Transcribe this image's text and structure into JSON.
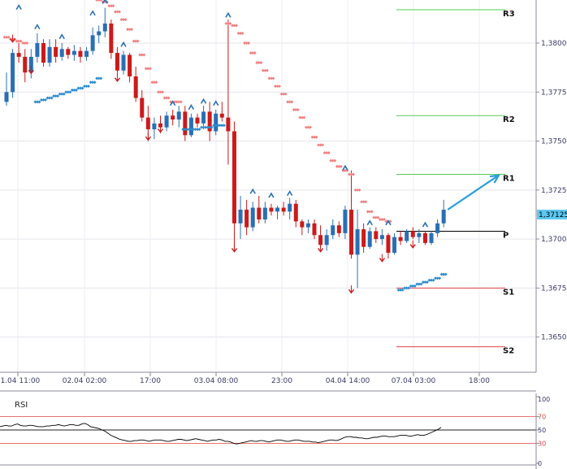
{
  "colors": {
    "bull": "#2a6fb5",
    "bear": "#cc1a1a",
    "sar_high": "#f08080",
    "sar_low": "#2a8ccf",
    "resistance": "#55cc55",
    "support": "#dd4444",
    "pivot": "#000000",
    "arrow": "#2aa0d8",
    "price_tag_bg": "#5bc8f0",
    "rsi_line": "#000000"
  },
  "chart_data": [
    {
      "type": "candlestick",
      "x_labels": [
        "01.04 11:00",
        "02.04 02:00",
        "17:00",
        "03.04 08:00",
        "23:00",
        "04.04 14:00",
        "07.04 03:00",
        "18:00"
      ],
      "y_ticks": [
        "1,3800",
        "1,3775",
        "1,3750",
        "1,3725",
        "1,3700",
        "1,3675",
        "1,3650"
      ],
      "ylim": [
        1.3632,
        1.3822
      ],
      "current_price_label": "1,37125",
      "current_price": 1.37125,
      "pivot_levels": [
        {
          "name": "R3",
          "value": 1.3817
        },
        {
          "name": "R2",
          "value": 1.3763
        },
        {
          "name": "R1",
          "value": 1.3733
        },
        {
          "name": "P",
          "value": 1.3704
        },
        {
          "name": "S1",
          "value": 1.3675
        },
        {
          "name": "S2",
          "value": 1.3645
        }
      ],
      "candles": [
        [
          1.377,
          1.3785,
          1.3768,
          1.3775
        ],
        [
          1.3775,
          1.3797,
          1.3772,
          1.3795
        ],
        [
          1.3795,
          1.38,
          1.379,
          1.3793
        ],
        [
          1.3793,
          1.3797,
          1.378,
          1.3785
        ],
        [
          1.3785,
          1.3797,
          1.3782,
          1.3793
        ],
        [
          1.3793,
          1.3805,
          1.379,
          1.38
        ],
        [
          1.38,
          1.3802,
          1.3788,
          1.379
        ],
        [
          1.379,
          1.3802,
          1.3788,
          1.3798
        ],
        [
          1.3798,
          1.3802,
          1.379,
          1.3793
        ],
        [
          1.3793,
          1.38,
          1.3791,
          1.3797
        ],
        [
          1.3797,
          1.3798,
          1.3792,
          1.3794
        ],
        [
          1.3794,
          1.3799,
          1.3791,
          1.3796
        ],
        [
          1.3796,
          1.3798,
          1.379,
          1.3793
        ],
        [
          1.3793,
          1.3798,
          1.3791,
          1.3796
        ],
        [
          1.3796,
          1.3808,
          1.3794,
          1.3804
        ],
        [
          1.3804,
          1.3809,
          1.38,
          1.3806
        ],
        [
          1.3806,
          1.3818,
          1.3803,
          1.381
        ],
        [
          1.381,
          1.3812,
          1.3792,
          1.3795
        ],
        [
          1.3795,
          1.3798,
          1.3784,
          1.3786
        ],
        [
          1.3786,
          1.3796,
          1.3784,
          1.3794
        ],
        [
          1.3794,
          1.3795,
          1.378,
          1.3783
        ],
        [
          1.3783,
          1.3788,
          1.377,
          1.3772
        ],
        [
          1.3772,
          1.3776,
          1.376,
          1.3762
        ],
        [
          1.3762,
          1.3768,
          1.375,
          1.3756
        ],
        [
          1.3756,
          1.3762,
          1.3751,
          1.3759
        ],
        [
          1.3759,
          1.3763,
          1.3754,
          1.3757
        ],
        [
          1.3757,
          1.3765,
          1.3755,
          1.3763
        ],
        [
          1.3763,
          1.3766,
          1.3758,
          1.3761
        ],
        [
          1.3761,
          1.3768,
          1.3757,
          1.3765
        ],
        [
          1.3765,
          1.3768,
          1.375,
          1.3753
        ],
        [
          1.3753,
          1.3764,
          1.3752,
          1.3762
        ],
        [
          1.3762,
          1.3764,
          1.3757,
          1.3759
        ],
        [
          1.3759,
          1.3768,
          1.3756,
          1.3765
        ],
        [
          1.3765,
          1.377,
          1.375,
          1.3755
        ],
        [
          1.3755,
          1.3766,
          1.3753,
          1.3764
        ],
        [
          1.3764,
          1.377,
          1.376,
          1.3762
        ],
        [
          1.3762,
          1.3812,
          1.3738,
          1.3755
        ],
        [
          1.3755,
          1.376,
          1.3695,
          1.3708
        ],
        [
          1.3708,
          1.3722,
          1.37,
          1.3715
        ],
        [
          1.3715,
          1.372,
          1.3702,
          1.3706
        ],
        [
          1.3706,
          1.3719,
          1.3704,
          1.3716
        ],
        [
          1.3716,
          1.3722,
          1.3708,
          1.371
        ],
        [
          1.371,
          1.3719,
          1.3708,
          1.3716
        ],
        [
          1.3716,
          1.3718,
          1.3712,
          1.3714
        ],
        [
          1.3714,
          1.3717,
          1.371,
          1.3716
        ],
        [
          1.3716,
          1.3719,
          1.3712,
          1.3714
        ],
        [
          1.3714,
          1.3721,
          1.371,
          1.3718
        ],
        [
          1.3718,
          1.372,
          1.3706,
          1.3709
        ],
        [
          1.3709,
          1.371,
          1.3702,
          1.3706
        ],
        [
          1.3706,
          1.371,
          1.3703,
          1.3708
        ],
        [
          1.3708,
          1.371,
          1.37,
          1.3702
        ],
        [
          1.3702,
          1.3707,
          1.3695,
          1.3697
        ],
        [
          1.3697,
          1.3705,
          1.3694,
          1.3702
        ],
        [
          1.3702,
          1.371,
          1.37,
          1.3707
        ],
        [
          1.3707,
          1.3709,
          1.3701,
          1.3703
        ],
        [
          1.3703,
          1.3717,
          1.37,
          1.3715
        ],
        [
          1.3715,
          1.3735,
          1.369,
          1.3692
        ],
        [
          1.3692,
          1.3715,
          1.3675,
          1.3705
        ],
        [
          1.3705,
          1.3708,
          1.3693,
          1.3696
        ],
        [
          1.3696,
          1.3706,
          1.3695,
          1.3704
        ],
        [
          1.3704,
          1.3706,
          1.3698,
          1.37
        ],
        [
          1.37,
          1.3705,
          1.3697,
          1.3702
        ],
        [
          1.3702,
          1.3703,
          1.369,
          1.3693
        ],
        [
          1.3693,
          1.3703,
          1.3692,
          1.3701
        ],
        [
          1.3701,
          1.3704,
          1.3697,
          1.3699
        ],
        [
          1.3699,
          1.3705,
          1.3698,
          1.3704
        ],
        [
          1.3704,
          1.3706,
          1.37,
          1.3701
        ],
        [
          1.3701,
          1.3705,
          1.3698,
          1.3703
        ],
        [
          1.3703,
          1.3704,
          1.3697,
          1.3698
        ],
        [
          1.3698,
          1.3704,
          1.3697,
          1.3703
        ],
        [
          1.3703,
          1.371,
          1.3701,
          1.3708
        ],
        [
          1.3708,
          1.372,
          1.3706,
          1.3715
        ]
      ],
      "sar_upper": [
        {
          "i": 0,
          "v": 1.3803
        },
        {
          "i": 1,
          "v": 1.3802
        },
        {
          "i": 2,
          "v": 1.3801
        },
        {
          "i": 3,
          "v": 1.38
        },
        {
          "i": 15,
          "v": 1.3822
        },
        {
          "i": 16,
          "v": 1.3821
        },
        {
          "i": 17,
          "v": 1.3819
        },
        {
          "i": 18,
          "v": 1.3816
        },
        {
          "i": 19,
          "v": 1.3812
        },
        {
          "i": 20,
          "v": 1.3807
        },
        {
          "i": 21,
          "v": 1.3801
        },
        {
          "i": 22,
          "v": 1.3794
        },
        {
          "i": 23,
          "v": 1.3787
        },
        {
          "i": 24,
          "v": 1.378
        },
        {
          "i": 25,
          "v": 1.3775
        },
        {
          "i": 26,
          "v": 1.3772
        },
        {
          "i": 27,
          "v": 1.377
        },
        {
          "i": 28,
          "v": 1.377
        },
        {
          "i": 36,
          "v": 1.381
        },
        {
          "i": 37,
          "v": 1.3809
        },
        {
          "i": 38,
          "v": 1.3805
        },
        {
          "i": 39,
          "v": 1.38
        },
        {
          "i": 40,
          "v": 1.3795
        },
        {
          "i": 41,
          "v": 1.379
        },
        {
          "i": 42,
          "v": 1.3786
        },
        {
          "i": 43,
          "v": 1.3782
        },
        {
          "i": 44,
          "v": 1.3778
        },
        {
          "i": 45,
          "v": 1.3774
        },
        {
          "i": 46,
          "v": 1.377
        },
        {
          "i": 47,
          "v": 1.3766
        },
        {
          "i": 48,
          "v": 1.3762
        },
        {
          "i": 49,
          "v": 1.3757
        },
        {
          "i": 50,
          "v": 1.3752
        },
        {
          "i": 51,
          "v": 1.3748
        },
        {
          "i": 52,
          "v": 1.3744
        },
        {
          "i": 53,
          "v": 1.374
        },
        {
          "i": 54,
          "v": 1.3737
        },
        {
          "i": 55,
          "v": 1.3735
        },
        {
          "i": 56,
          "v": 1.3733
        },
        {
          "i": 57,
          "v": 1.3725
        },
        {
          "i": 58,
          "v": 1.3719
        },
        {
          "i": 59,
          "v": 1.3714
        },
        {
          "i": 60,
          "v": 1.3711
        },
        {
          "i": 61,
          "v": 1.371
        },
        {
          "i": 62,
          "v": 1.3709
        }
      ],
      "sar_lower": [
        {
          "i": 5,
          "v": 1.377
        },
        {
          "i": 6,
          "v": 1.3771
        },
        {
          "i": 7,
          "v": 1.3772
        },
        {
          "i": 8,
          "v": 1.3773
        },
        {
          "i": 9,
          "v": 1.3774
        },
        {
          "i": 10,
          "v": 1.3775
        },
        {
          "i": 11,
          "v": 1.3776
        },
        {
          "i": 12,
          "v": 1.3777
        },
        {
          "i": 13,
          "v": 1.3778
        },
        {
          "i": 14,
          "v": 1.378
        },
        {
          "i": 15,
          "v": 1.3782
        },
        {
          "i": 29,
          "v": 1.3756
        },
        {
          "i": 30,
          "v": 1.3756
        },
        {
          "i": 31,
          "v": 1.3756
        },
        {
          "i": 32,
          "v": 1.3757
        },
        {
          "i": 33,
          "v": 1.3757
        },
        {
          "i": 34,
          "v": 1.3758
        },
        {
          "i": 35,
          "v": 1.3758
        },
        {
          "i": 64,
          "v": 1.3674
        },
        {
          "i": 65,
          "v": 1.3675
        },
        {
          "i": 66,
          "v": 1.3676
        },
        {
          "i": 67,
          "v": 1.3677
        },
        {
          "i": 68,
          "v": 1.3678
        },
        {
          "i": 69,
          "v": 1.3679
        },
        {
          "i": 70,
          "v": 1.368
        },
        {
          "i": 71,
          "v": 1.3682
        }
      ],
      "fractal_up": [
        {
          "i": 2,
          "v": 1.3818
        },
        {
          "i": 5,
          "v": 1.3808
        },
        {
          "i": 9,
          "v": 1.3803
        },
        {
          "i": 14,
          "v": 1.3815
        },
        {
          "i": 16,
          "v": 1.3821
        },
        {
          "i": 19,
          "v": 1.3799
        },
        {
          "i": 27,
          "v": 1.3769
        },
        {
          "i": 30,
          "v": 1.3767
        },
        {
          "i": 32,
          "v": 1.377
        },
        {
          "i": 34,
          "v": 1.3769
        },
        {
          "i": 36,
          "v": 1.3814
        },
        {
          "i": 40,
          "v": 1.3724
        },
        {
          "i": 43,
          "v": 1.3722
        },
        {
          "i": 46,
          "v": 1.3723
        },
        {
          "i": 55,
          "v": 1.3736
        },
        {
          "i": 59,
          "v": 1.3708
        },
        {
          "i": 62,
          "v": 1.3708
        },
        {
          "i": 68,
          "v": 1.3707
        }
      ],
      "fractal_down": [
        {
          "i": 1,
          "v": 1.3801
        },
        {
          "i": 4,
          "v": 1.3785
        },
        {
          "i": 18,
          "v": 1.3781
        },
        {
          "i": 23,
          "v": 1.3751
        },
        {
          "i": 25,
          "v": 1.3755
        },
        {
          "i": 37,
          "v": 1.3694
        },
        {
          "i": 51,
          "v": 1.3694
        },
        {
          "i": 56,
          "v": 1.3673
        },
        {
          "i": 61,
          "v": 1.3689
        },
        {
          "i": 66,
          "v": 1.3696
        }
      ],
      "arrow_target": 1.3733
    },
    {
      "type": "line",
      "title": "RSI",
      "y_ticks": [
        "100",
        "70",
        "50",
        "30",
        "0"
      ],
      "levels": [
        70,
        50,
        30
      ],
      "ylim": [
        0,
        100
      ],
      "values": [
        55,
        56,
        57,
        56,
        56,
        58,
        59,
        57,
        56,
        56,
        57,
        57,
        56,
        55,
        55,
        55,
        56,
        56,
        57,
        57,
        58,
        57,
        56,
        57,
        58,
        58,
        57,
        57,
        59,
        60,
        58,
        55,
        54,
        53,
        52,
        50,
        48,
        45,
        42,
        40,
        38,
        36,
        35,
        34,
        33,
        33,
        34,
        34,
        35,
        35,
        34,
        33,
        34,
        35,
        35,
        35,
        34,
        33,
        33,
        34,
        35,
        36,
        36,
        35,
        34,
        35,
        36,
        37,
        36,
        35,
        34,
        33,
        34,
        35,
        35,
        36,
        35,
        33,
        33,
        32,
        30,
        29,
        30,
        31,
        32,
        33,
        34,
        33,
        33,
        34,
        34,
        33,
        32,
        33,
        34,
        35,
        35,
        34,
        33,
        33,
        34,
        35,
        35,
        34,
        33,
        33,
        33,
        32,
        32,
        31,
        32,
        33,
        34,
        35,
        35,
        34,
        35,
        37,
        39,
        40,
        40,
        39,
        39,
        38,
        38,
        37,
        37,
        38,
        39,
        39,
        40,
        41,
        41,
        40,
        40,
        40,
        41,
        42,
        42,
        42,
        41,
        41,
        42,
        43,
        42,
        42,
        43,
        45,
        47,
        49,
        51,
        54
      ]
    }
  ]
}
